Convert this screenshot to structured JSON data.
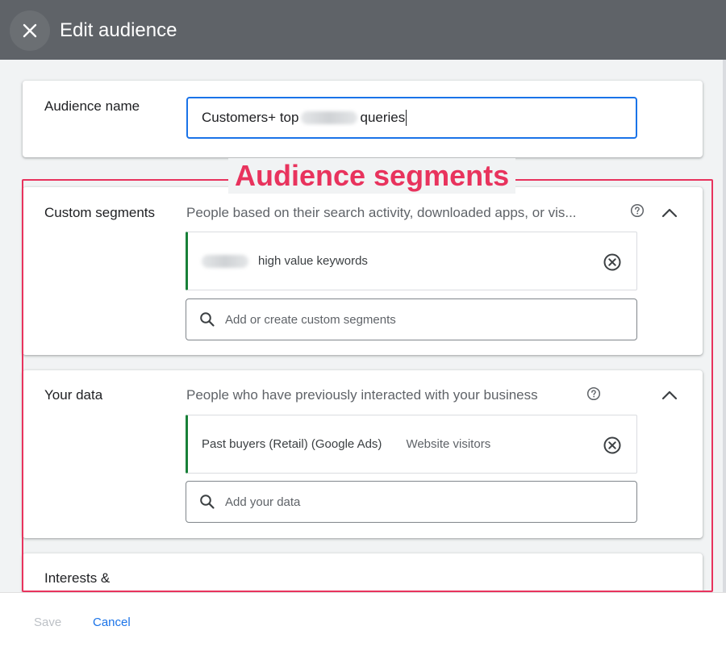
{
  "header": {
    "title": "Edit audience",
    "close_icon": "close-icon"
  },
  "audience_name": {
    "label": "Audience name",
    "value_prefix": "Customers+ top",
    "value_suffix": "queries"
  },
  "annotation": {
    "label": "Audience segments",
    "color": "#e8335d"
  },
  "custom_segments": {
    "label": "Custom segments",
    "description": "People based on their search activity, downloaded apps, or vis...",
    "selected_item": "high value keywords",
    "search_placeholder": "Add or create custom segments"
  },
  "your_data": {
    "label": "Your data",
    "description": "People who have previously interacted with your business",
    "selected_item": "Past buyers (Retail) (Google Ads)",
    "selected_item_type": "Website visitors",
    "search_placeholder": "Add your data"
  },
  "interests": {
    "label": "Interests &"
  },
  "footer": {
    "save_label": "Save",
    "cancel_label": "Cancel"
  },
  "colors": {
    "accent": "#1a73e8",
    "highlight": "#e8335d",
    "chip_border": "#188038",
    "topbar": "#5f6368"
  }
}
